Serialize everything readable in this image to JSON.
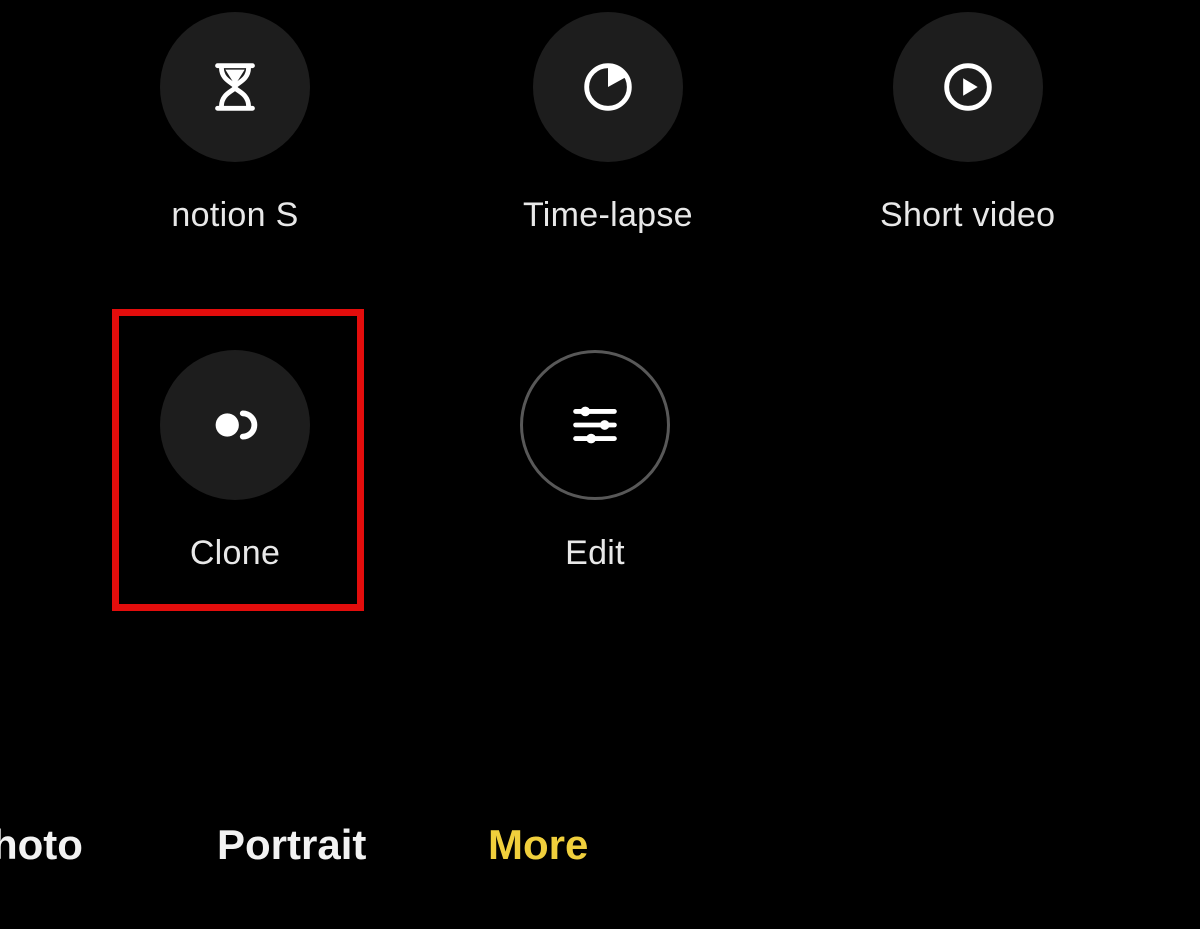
{
  "modes": {
    "slowmotion": {
      "label": "notion    S",
      "icon": "hourglass-icon"
    },
    "timelapse": {
      "label": "Time-lapse",
      "icon": "time-lapse-icon"
    },
    "shortvideo": {
      "label": "Short video",
      "icon": "play-circle-icon"
    },
    "clone": {
      "label": "Clone",
      "icon": "clone-icon",
      "highlighted": true
    },
    "edit": {
      "label": "Edit",
      "icon": "sliders-icon"
    }
  },
  "tabs": {
    "photo": {
      "label": "hoto",
      "active": false
    },
    "portrait": {
      "label": "Portrait",
      "active": false
    },
    "more": {
      "label": "More",
      "active": true
    }
  },
  "colors": {
    "background": "#000000",
    "circle_fill": "#1d1d1d",
    "circle_outline": "#585858",
    "text": "#e8e8e8",
    "active_tab": "#f0cf3c",
    "highlight_box": "#e30d0c"
  }
}
